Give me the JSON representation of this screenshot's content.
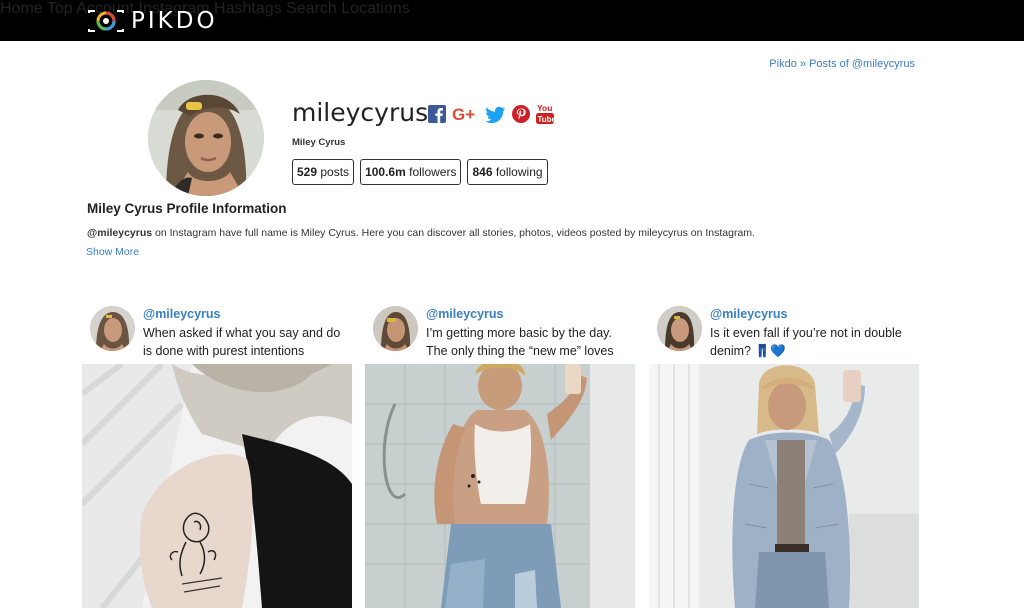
{
  "brand": {
    "name": "PIKDO"
  },
  "nav": {
    "items": [
      {
        "label": "Home"
      },
      {
        "label": "Top Account"
      },
      {
        "label": "Instagram Hashtags"
      },
      {
        "label": "Search"
      },
      {
        "label": "Locations"
      }
    ]
  },
  "breadcrumb": {
    "home": "Pikdo",
    "separator": "»",
    "current": "Posts of @mileycyrus"
  },
  "profile": {
    "username": "mileycyrus",
    "full_name": "Miley Cyrus",
    "posts_count": "529",
    "posts_label": "posts",
    "followers_count": "100.6m",
    "followers_label": "followers",
    "following_count": "846",
    "following_label": "following",
    "social_icons": [
      "facebook-icon",
      "google-plus-icon",
      "twitter-icon",
      "pinterest-icon",
      "youtube-icon"
    ]
  },
  "info": {
    "title": "Miley Cyrus Profile Information",
    "handle": "@mileycyrus",
    "text": " on Instagram have full name is Miley Cyrus. Here you can discover all stories, photos, videos posted by mileycyrus on Instagram.",
    "show_more": "Show More"
  },
  "posts": [
    {
      "user": "@mileycyrus",
      "caption": "When asked if what you say and do is done with purest intentions"
    },
    {
      "user": "@mileycyrus",
      "caption": "I’m getting more basic by the day. The only thing the “new me” loves"
    },
    {
      "user": "@mileycyrus",
      "caption": "Is it even fall if you’re not in double denim?",
      "emoji": "👖💙"
    }
  ],
  "colors": {
    "topbar": "#000000",
    "link": "#3a7fc1",
    "facebook": "#3b5998",
    "google_plus": "#dd4b39",
    "twitter": "#1da1f2",
    "pinterest": "#cb2027",
    "youtube": "#cd201f"
  }
}
